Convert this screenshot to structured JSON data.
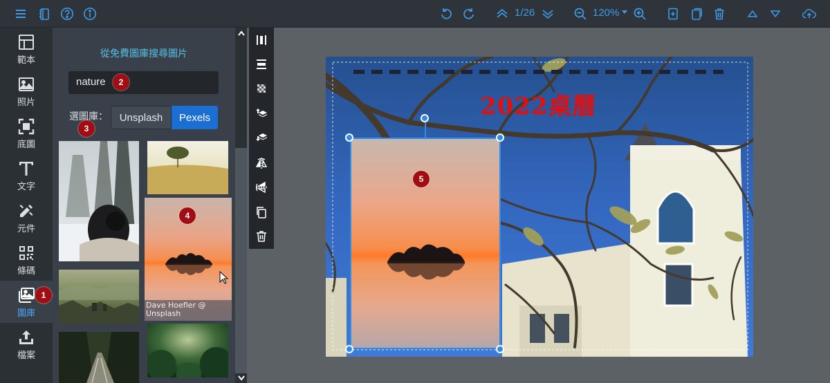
{
  "toolbar": {
    "page_indicator": "1/26",
    "zoom_level": "120%"
  },
  "nav": {
    "items": [
      {
        "label": "範本",
        "icon": "template-icon"
      },
      {
        "label": "照片",
        "icon": "photo-icon"
      },
      {
        "label": "底圖",
        "icon": "background-icon"
      },
      {
        "label": "文字",
        "icon": "text-icon"
      },
      {
        "label": "元件",
        "icon": "elements-icon"
      },
      {
        "label": "條碼",
        "icon": "qrcode-icon"
      },
      {
        "label": "圖庫",
        "icon": "gallery-icon"
      },
      {
        "label": "檔案",
        "icon": "upload-icon"
      }
    ],
    "active_index": 6
  },
  "panel": {
    "title": "從免費圖庫搜尋圖片",
    "search_value": "nature",
    "library_label": "選圖庫：",
    "library_options": [
      "Unsplash",
      "Pexels"
    ],
    "selected_library": "Pexels",
    "hover_caption": "Dave Hoefler @ Unsplash"
  },
  "canvas": {
    "title_text": "2022桌曆",
    "title_color": "#e01010"
  },
  "badges": [
    "1",
    "2",
    "3",
    "4",
    "5"
  ],
  "colors": {
    "accent": "#3d9be9",
    "selection": "#2f8ce8",
    "badge": "#a10d13"
  }
}
